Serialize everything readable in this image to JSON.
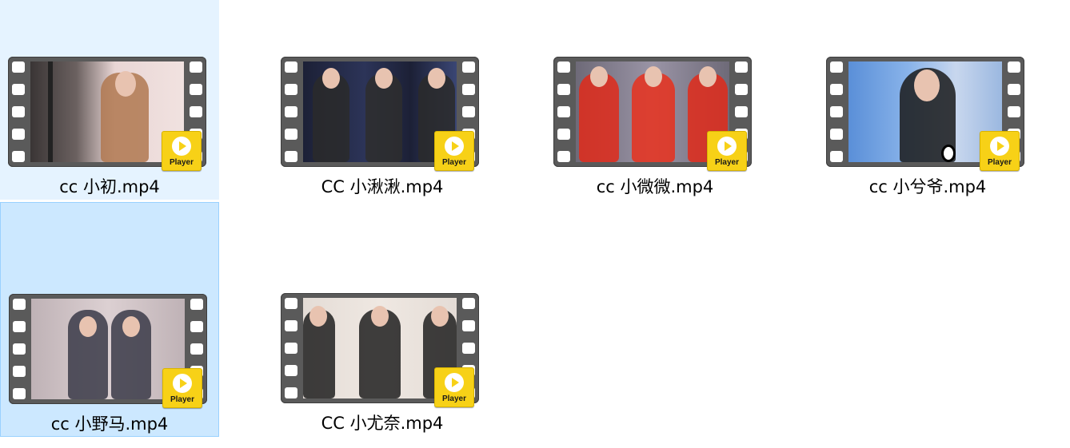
{
  "files": [
    {
      "name": "cc 小初.mp4",
      "state": "hover",
      "badge": "Player",
      "thumb": "cc-xiaochu"
    },
    {
      "name": "CC 小湫湫.mp4",
      "state": "normal",
      "badge": "Player",
      "thumb": "cc-xiaoqiuqiu"
    },
    {
      "name": "cc 小微微.mp4",
      "state": "normal",
      "badge": "Player",
      "thumb": "cc-xiaoweiwei"
    },
    {
      "name": "cc 小兮爷.mp4",
      "state": "normal",
      "badge": "Player",
      "thumb": "cc-xiaoxiye"
    },
    {
      "name": "cc 小野马.mp4",
      "state": "selected",
      "badge": "Player",
      "thumb": "cc-xiaoyema"
    },
    {
      "name": "CC 小尤奈.mp4",
      "state": "normal",
      "badge": "Player",
      "thumb": "cc-xiaoyounai"
    }
  ],
  "colors": {
    "hover_bg": "#e5f3ff",
    "selected_bg": "#cce8ff",
    "selected_border": "#99d1ff",
    "badge_yellow": "#f7d117",
    "film_gray": "#5a5a5a"
  }
}
